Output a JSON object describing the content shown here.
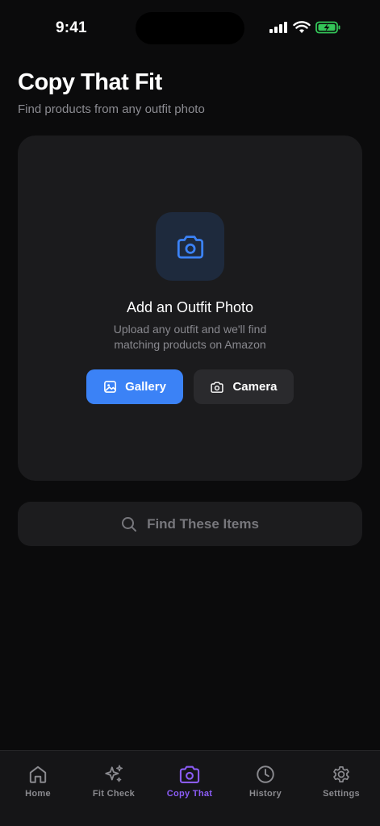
{
  "status_bar": {
    "time": "9:41"
  },
  "header": {
    "title": "Copy That Fit",
    "subtitle": "Find products from any outfit photo"
  },
  "upload_card": {
    "heading": "Add an Outfit Photo",
    "description": "Upload any outfit and we'll find matching products on Amazon",
    "gallery_label": "Gallery",
    "camera_label": "Camera"
  },
  "find_button": {
    "label": "Find These Items"
  },
  "tab_bar": {
    "tabs": [
      {
        "label": "Home",
        "icon": "home-icon"
      },
      {
        "label": "Fit Check",
        "icon": "sparkles-icon"
      },
      {
        "label": "Copy That",
        "icon": "camera-icon",
        "active": true
      },
      {
        "label": "History",
        "icon": "clock-icon"
      },
      {
        "label": "Settings",
        "icon": "gear-icon"
      }
    ]
  },
  "colors": {
    "accent_blue": "#3b82f6",
    "active_tab": "#8b5cf6",
    "battery_green": "#34c759"
  }
}
